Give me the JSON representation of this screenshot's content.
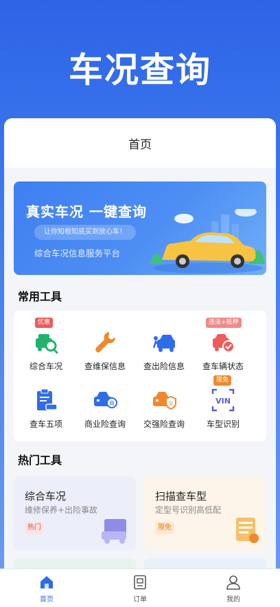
{
  "app": {
    "title": "车况查询"
  },
  "header": {
    "title": "首页"
  },
  "banner": {
    "title": "真实车况 一键查询",
    "pill": "让你知根知底买到放心车！",
    "subtitle": "综合车况信息服务平台"
  },
  "tools": {
    "section_title": "常用工具",
    "items": [
      {
        "label": "综合车况",
        "tag": "优惠",
        "icon": "car-search-icon"
      },
      {
        "label": "查维保信息",
        "tag": "",
        "icon": "wrench-icon"
      },
      {
        "label": "查出险信息",
        "tag": "",
        "icon": "car-crash-icon"
      },
      {
        "label": "查车辆状态",
        "tag": "违法+抵押",
        "icon": "car-check-icon"
      },
      {
        "label": "查车五项",
        "tag": "",
        "icon": "clipboard-car-icon"
      },
      {
        "label": "商业险查询",
        "tag": "",
        "icon": "car-insurance-icon"
      },
      {
        "label": "交强险查询",
        "tag": "",
        "icon": "car-shield-icon"
      },
      {
        "label": "车型识别",
        "tag": "限免",
        "icon": "vin-scan-icon"
      }
    ]
  },
  "hot": {
    "section_title": "热门工具",
    "cards": [
      {
        "title": "综合车况",
        "subtitle": "维修保养+出险事故",
        "tag": "热门"
      },
      {
        "title": "扫描查车型",
        "subtitle": "定型号识别高低配",
        "tag": "限免"
      }
    ]
  },
  "tabbar": {
    "items": [
      {
        "label": "首页",
        "icon": "home-icon",
        "active": true
      },
      {
        "label": "订单",
        "icon": "order-icon",
        "active": false
      },
      {
        "label": "我的",
        "icon": "user-icon",
        "active": false
      }
    ]
  },
  "colors": {
    "brand": "#2f6de8",
    "orange": "#f0892c",
    "green": "#21b36b",
    "red": "#ef5b5b",
    "tab_active": "#2f6de8"
  }
}
